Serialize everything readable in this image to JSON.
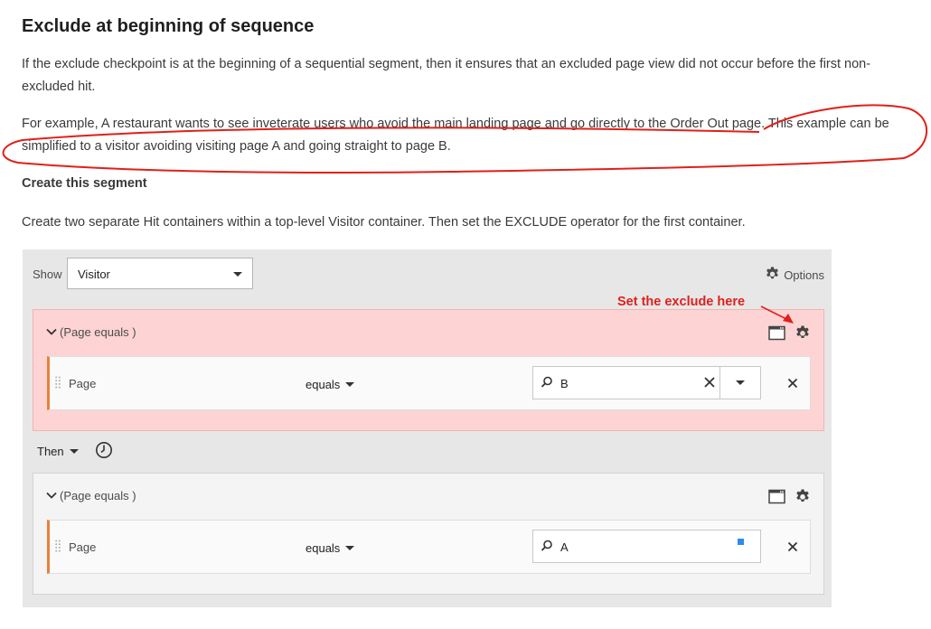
{
  "doc": {
    "heading": "Exclude at beginning of sequence",
    "para1": "If the exclude checkpoint is at the beginning of a sequential segment, then it ensures that an excluded page view did not occur before the first non-excluded hit.",
    "para2": "For example, A restaurant wants to see inveterate users who avoid the main landing page and go directly to the Order Out page. This example can be simplified to a visitor avoiding visiting page A and going straight to page B.",
    "subheading": "Create this segment",
    "para3": "Create two separate Hit containers within a top-level Visitor container. Then set the EXCLUDE operator for the first container."
  },
  "builder": {
    "show_label": "Show",
    "show_value": "Visitor",
    "options_label": "Options",
    "annotation": "Set the exclude here",
    "then_label": "Then",
    "containers": [
      {
        "header": "(Page equals )",
        "rule": {
          "dimension": "Page",
          "operator": "equals",
          "value": "B"
        }
      },
      {
        "header": "(Page equals )",
        "rule": {
          "dimension": "Page",
          "operator": "equals",
          "value": "A"
        }
      }
    ]
  },
  "colors": {
    "excluded_container_bg": "#fdd4d3",
    "accent_bar": "#e8813a",
    "annotation_red": "#e0201b",
    "blue_marker": "#2d8ceb"
  },
  "icons": [
    "gear-icon",
    "window-icon",
    "chevron-down-icon",
    "search-icon",
    "close-icon",
    "clock-icon",
    "grip-icon"
  ]
}
